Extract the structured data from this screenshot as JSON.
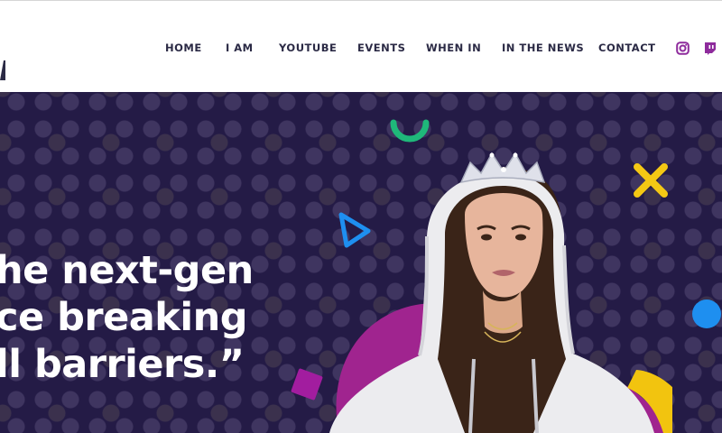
{
  "nav": {
    "items": [
      {
        "label": "HOME"
      },
      {
        "label": "I AM"
      },
      {
        "label": "YOUTUBE"
      },
      {
        "label": "EVENTS"
      },
      {
        "label": "WHEN IN"
      },
      {
        "label": "IN THE NEWS"
      },
      {
        "label": "CONTACT"
      }
    ],
    "social": [
      {
        "icon": "instagram-icon"
      },
      {
        "icon": "twitch-icon"
      }
    ]
  },
  "hero": {
    "quote_lines": [
      "he next-gen",
      "ce breaking",
      "ll barriers.”"
    ]
  },
  "colors": {
    "hero_bg": "#241b46",
    "nav_text": "#2b2a45",
    "brand_purple": "#8e2b9c",
    "accent_green": "#1fb87a",
    "accent_yellow": "#f4c814",
    "accent_blue": "#1e8ff0",
    "accent_magenta": "#a21d9f"
  }
}
